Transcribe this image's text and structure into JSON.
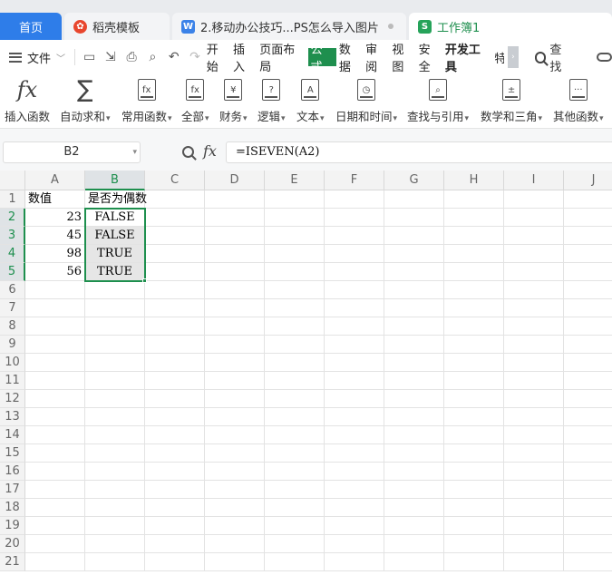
{
  "tabs": [
    {
      "label": "首页",
      "icon": ""
    },
    {
      "label": "稻壳模板",
      "icon": "docer-icon"
    },
    {
      "label": "2.移动办公技巧...PS怎么导入图片",
      "icon": "word-doc-icon"
    },
    {
      "label": "工作簿1",
      "icon": "spreadsheet-icon"
    }
  ],
  "tab_icon_glyphs": {
    "docer": "✿",
    "word": "W",
    "sheet": "S"
  },
  "menu": {
    "file_label": "文件",
    "tabs": [
      "开始",
      "插入",
      "页面布局",
      "公式",
      "数据",
      "审阅",
      "视图",
      "安全",
      "开发工具",
      "特"
    ],
    "active_tab": "公式",
    "search_label": "查找"
  },
  "ribbon": [
    {
      "label": "插入函数",
      "icon": "fx-icon"
    },
    {
      "label": "自动求和",
      "icon": "sigma-icon"
    },
    {
      "label": "常用函数",
      "icon": "fx-star-icon"
    },
    {
      "label": "全部",
      "icon": "fx-book-icon"
    },
    {
      "label": "财务",
      "icon": "yen-book-icon"
    },
    {
      "label": "逻辑",
      "icon": "question-book-icon"
    },
    {
      "label": "文本",
      "icon": "a-book-icon"
    },
    {
      "label": "日期和时间",
      "icon": "clock-book-icon"
    },
    {
      "label": "查找与引用",
      "icon": "magnifier-book-icon"
    },
    {
      "label": "数学和三角",
      "icon": "plus-minus-book-icon"
    },
    {
      "label": "其他函数",
      "icon": "dots-book-icon"
    }
  ],
  "ribbon_glyphs": {
    "fx": "fx",
    "sigma": "∑",
    "yen": "¥",
    "q": "?",
    "a": "A",
    "clock": "◷",
    "mag": "⌕",
    "pm": "±",
    "dots": "···"
  },
  "formula_bar": {
    "name_box": "B2",
    "fx_label": "fx",
    "formula": "=ISEVEN(A2)"
  },
  "columns": [
    "A",
    "B",
    "C",
    "D",
    "E",
    "F",
    "G",
    "H",
    "I",
    "J"
  ],
  "rows": [
    "1",
    "2",
    "3",
    "4",
    "5",
    "6",
    "7",
    "8",
    "9",
    "10",
    "11",
    "12",
    "13",
    "14",
    "15",
    "16",
    "17",
    "18",
    "19",
    "20",
    "21"
  ],
  "cells": {
    "A1": "数值",
    "B1": "是否为偶数",
    "A2": "23",
    "B2": "FALSE",
    "A3": "45",
    "B3": "FALSE",
    "A4": "98",
    "B4": "TRUE",
    "A5": "56",
    "B5": "TRUE"
  },
  "selection": "B2:B5",
  "colors": {
    "accent": "#1e8f4e",
    "home_tab": "#2e7de9"
  }
}
